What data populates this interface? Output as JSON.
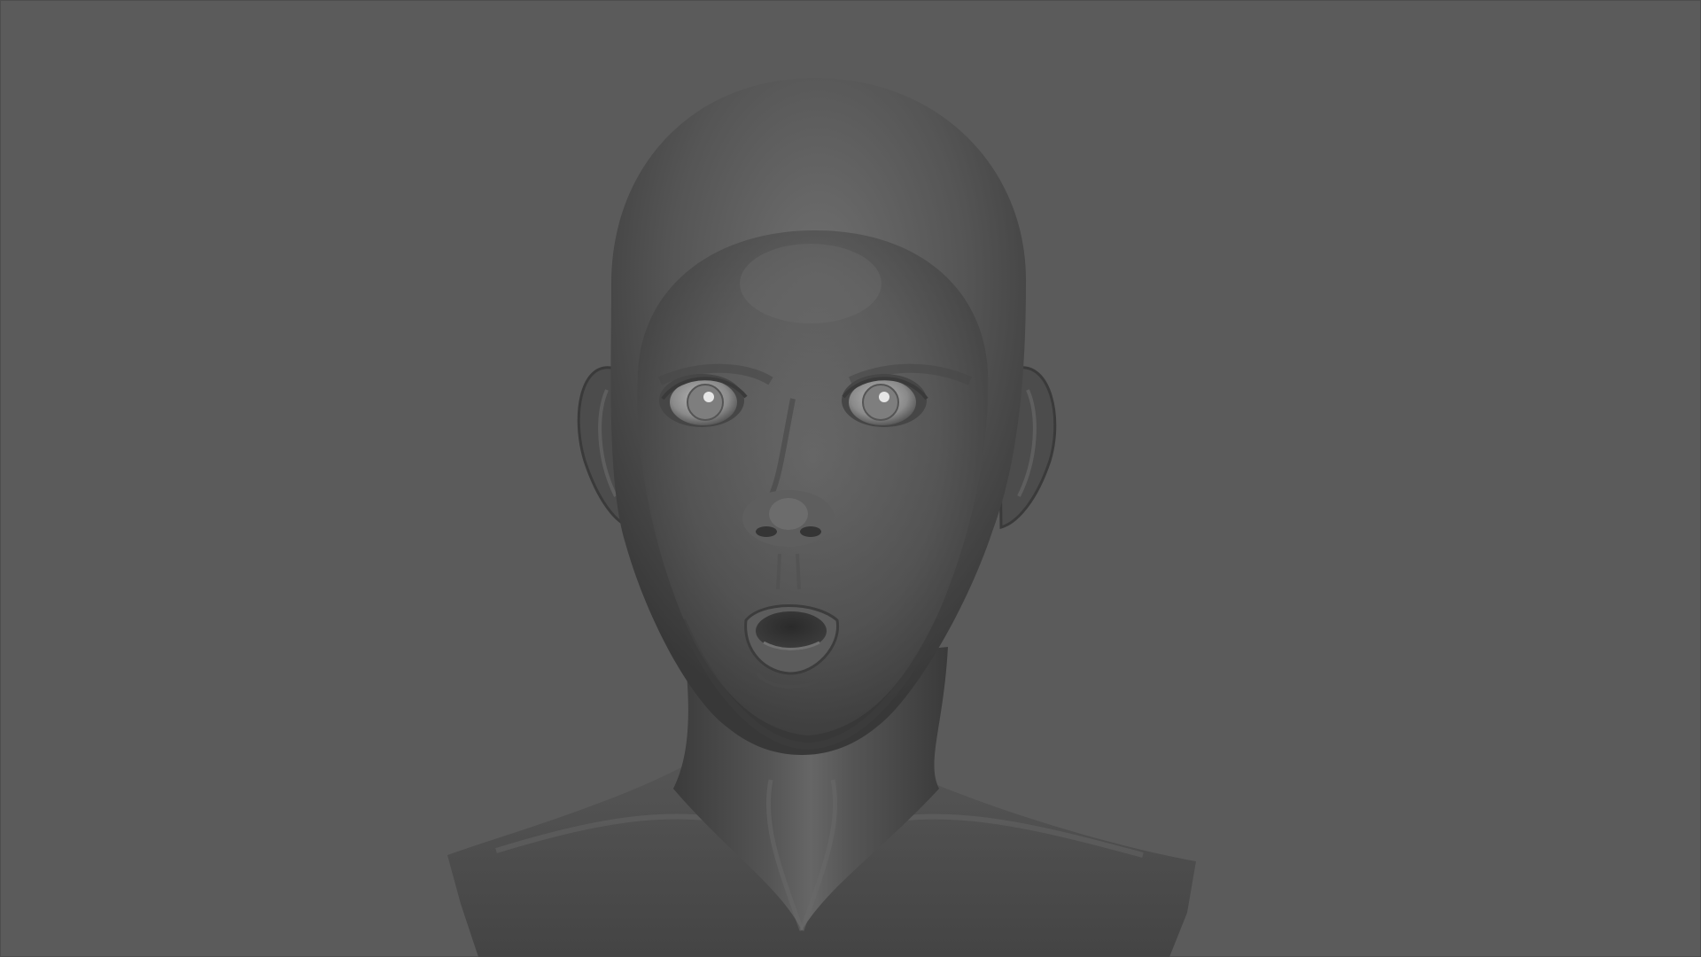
{
  "viewport": {
    "background_color": "#5b5b5b",
    "subject": "head-bust-model",
    "shading": "matcap-gray"
  },
  "colors": {
    "skin_light": "#6e6e6e",
    "skin_mid": "#575757",
    "skin_dark": "#3a3a3a",
    "eye_white": "#9a9a9a",
    "eye_highlight": "#e6e6e6"
  }
}
